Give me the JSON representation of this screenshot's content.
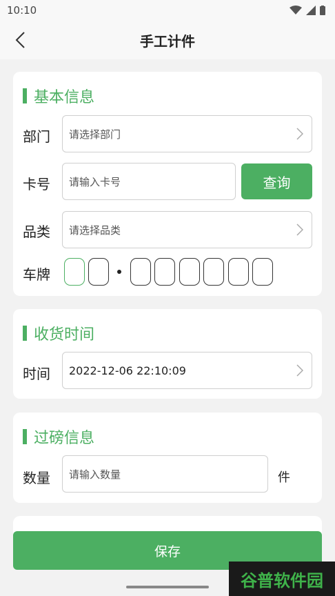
{
  "status_bar": {
    "time": "10:10"
  },
  "nav": {
    "title": "手工计件"
  },
  "basic": {
    "title": "基本信息",
    "dept_label": "部门",
    "dept_placeholder": "请选择部门",
    "card_label": "卡号",
    "card_placeholder": "请输入卡号",
    "query_label": "查询",
    "category_label": "品类",
    "category_placeholder": "请选择品类",
    "plate_label": "车牌"
  },
  "receive": {
    "title": "收货时间",
    "time_label": "时间",
    "time_value": "2022-12-06 22:10:09"
  },
  "weigh": {
    "title": "过磅信息",
    "qty_label": "数量",
    "qty_placeholder": "请输入数量",
    "unit": "件"
  },
  "save_label": "保存",
  "watermark": "谷普软件园",
  "colors": {
    "accent": "#4caf62",
    "background": "#f2f2f2"
  }
}
